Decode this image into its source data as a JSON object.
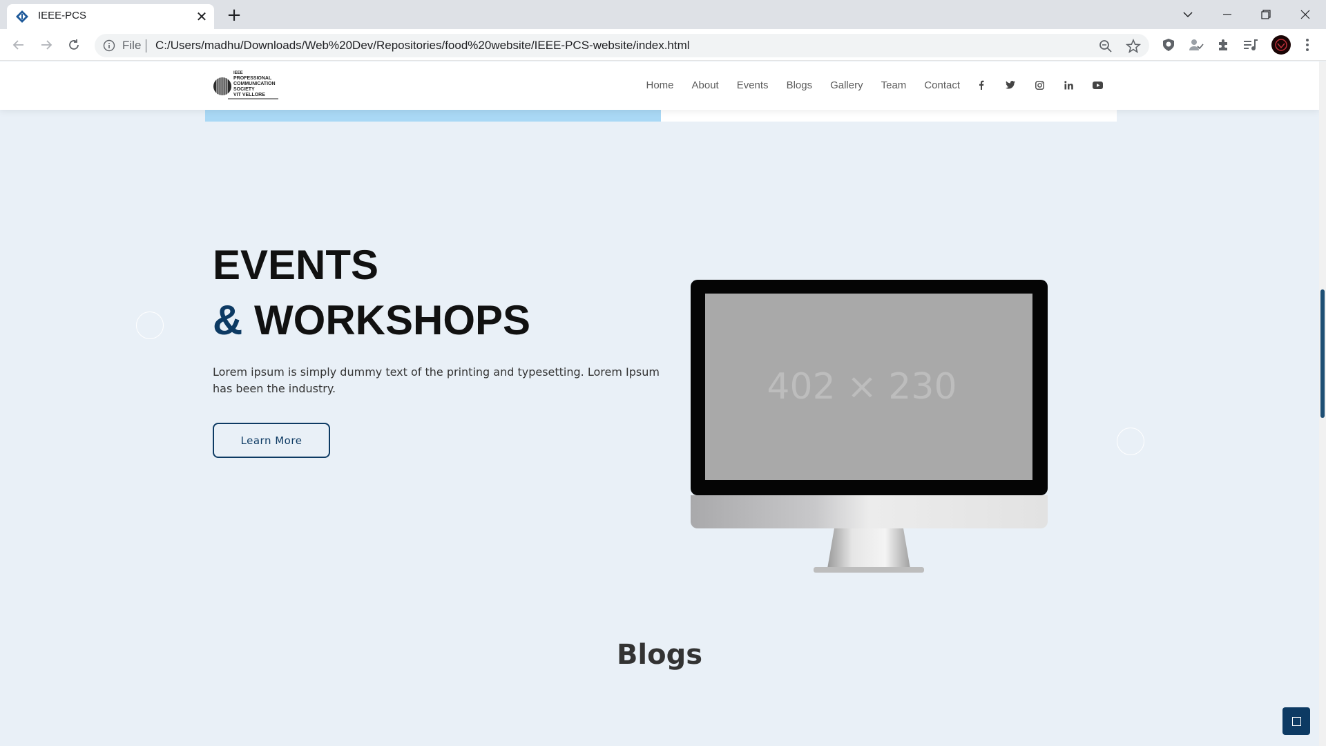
{
  "browser": {
    "tab_title": "IEEE-PCS",
    "new_tab_label": "+",
    "close_tab_label": "✕",
    "omnibox_scheme": "File",
    "url": "C:/Users/madhu/Downloads/Web%20Dev/Repositories/food%20website/IEEE-PCS-website/index.html"
  },
  "site": {
    "logo_lines": [
      "IEEE",
      "PROFESSIONAL",
      "COMMUNICATION",
      "SOCIETY",
      "VIT VELLORE"
    ],
    "nav": [
      "Home",
      "About",
      "Events",
      "Blogs",
      "Gallery",
      "Team",
      "Contact"
    ],
    "social_icons": [
      "facebook-icon",
      "twitter-icon",
      "instagram-icon",
      "linkedin-icon",
      "youtube-icon"
    ],
    "scroll_progress": 0.5
  },
  "hero": {
    "title_line1": "EVENTS",
    "title_amp": "&",
    "title_line2": "WORKSHOPS",
    "description": "Lorem ipsum is simply dummy text of the printing and typesetting. Lorem Ipsum has been the industry.",
    "button_label": "Learn More",
    "placeholder_text": "402 × 230"
  },
  "blogs": {
    "title": "Blogs"
  },
  "colors": {
    "brand_dark": "#0d3a63",
    "page_bg": "#e9f0f7",
    "progress_fill": "#a9d8f5"
  }
}
